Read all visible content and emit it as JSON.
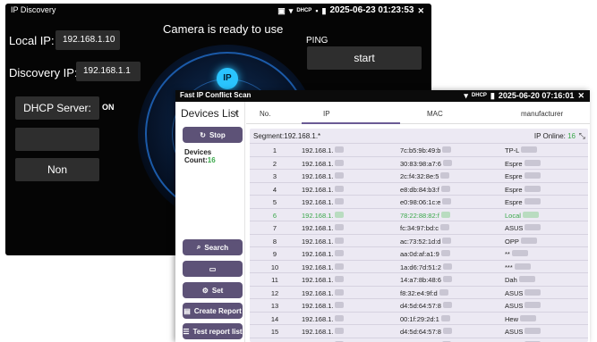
{
  "discovery": {
    "title": "IP Discovery",
    "datetime": "2025-06-23 01:23:53",
    "status_message": "Camera is ready to use",
    "local_ip_label": "Local IP:",
    "local_ip_value": "192.168.1.10",
    "discovery_ip_label": "Discovery IP:",
    "discovery_ip_value": "192.168.1.1",
    "ping_label": "PING",
    "start_label": "start",
    "dhcp_label": "DHCP Server:",
    "dhcp_value": "ON",
    "blank_button_label": "",
    "non_label": "Non",
    "ip_badge": "IP",
    "dhcp_badge": "DHCP"
  },
  "scan": {
    "title": "Fast IP Conflict Scan",
    "datetime": "2025-06-20 07:16:01",
    "dhcp_badge": "DHCP",
    "sidebar": {
      "title": "Devices List",
      "stop_label": "Stop",
      "devices_count_label": "Devices Count:",
      "devices_count": "16",
      "search_label": "Search",
      "set_label": "Set",
      "create_report_label": "Create Report",
      "test_report_label": "Test report list"
    },
    "tabs": {
      "no": "No.",
      "ip": "IP",
      "mac": "MAC",
      "manufacturer": "manufacturer"
    },
    "segment_label": "Segment:192.168.1.*",
    "online_label": "IP Online:",
    "online_count": "16",
    "rows": [
      {
        "no": "1",
        "ip": "192.168.1.",
        "mac": "7c:b5:9b:49:b",
        "man": "TP-L"
      },
      {
        "no": "2",
        "ip": "192.168.1.",
        "mac": "30:83:98:a7:6",
        "man": "Espre"
      },
      {
        "no": "3",
        "ip": "192.168.1.",
        "mac": "2c:f4:32:8e:5",
        "man": "Espre"
      },
      {
        "no": "4",
        "ip": "192.168.1.",
        "mac": "e8:db:84:b3:f",
        "man": "Espre"
      },
      {
        "no": "5",
        "ip": "192.168.1.",
        "mac": "e0:98:06:1c:e",
        "man": "Espre"
      },
      {
        "no": "6",
        "ip": "192.168.1.",
        "mac": "78:22:88:82:f",
        "man": "Local"
      },
      {
        "no": "7",
        "ip": "192.168.1.",
        "mac": "fc:34:97:bd:c",
        "man": "ASUS"
      },
      {
        "no": "8",
        "ip": "192.168.1.",
        "mac": "ac:73:52:1d:d",
        "man": "OPP"
      },
      {
        "no": "9",
        "ip": "192.168.1.",
        "mac": "aa:0d:af:a1:9",
        "man": "**"
      },
      {
        "no": "10",
        "ip": "192.168.1.",
        "mac": "1a:d6:7d:51:2",
        "man": "***"
      },
      {
        "no": "11",
        "ip": "192.168.1.",
        "mac": "14:a7:8b:48:6",
        "man": "Dah"
      },
      {
        "no": "12",
        "ip": "192.168.1.",
        "mac": "f8:32:e4:9f:d",
        "man": "ASUS"
      },
      {
        "no": "13",
        "ip": "192.168.1.",
        "mac": "d4:5d:64:57:8",
        "man": "ASUS"
      },
      {
        "no": "14",
        "ip": "192.168.1.",
        "mac": "00:1f:29:2d:1",
        "man": "Hew"
      },
      {
        "no": "15",
        "ip": "192.168.1.",
        "mac": "d4:5d:64:57:8",
        "man": "ASUS"
      },
      {
        "no": "16",
        "ip": "192.168.1.",
        "mac": "7c:10:c9:1d:1",
        "man": "ASUS"
      }
    ]
  },
  "colors": {
    "accent": "#5d5277",
    "highlight_green": "#3aa84a",
    "panel_bg": "#ece9f3",
    "dark_bg": "#050505"
  }
}
